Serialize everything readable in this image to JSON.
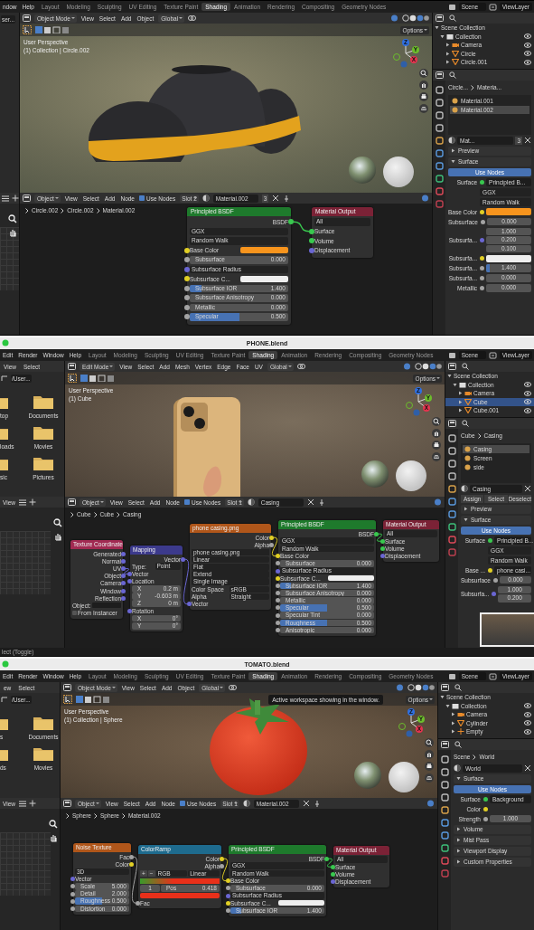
{
  "screens": [
    {
      "menus": [
        "ndow",
        "Help"
      ],
      "workspaces": [
        {
          "label": "Layout",
          "selected": false
        },
        {
          "label": "Modeling",
          "selected": false
        },
        {
          "label": "Sculpting",
          "selected": false
        },
        {
          "label": "UV Editing",
          "selected": false
        },
        {
          "label": "Texture Paint",
          "selected": false
        },
        {
          "label": "Shading",
          "selected": true
        },
        {
          "label": "Animation",
          "selected": false
        },
        {
          "label": "Rendering",
          "selected": false
        },
        {
          "label": "Compositing",
          "selected": false
        },
        {
          "label": "Geometry Nodes",
          "selected": false
        }
      ],
      "scene": "Scene",
      "view_layer": "ViewLayer",
      "file_browser": {
        "path": "ser..."
      },
      "viewport": {
        "mode": "Object Mode",
        "menus": [
          "View",
          "Select",
          "Add",
          "Object"
        ],
        "orientation": "Global",
        "options": "Options",
        "info": [
          "User Perspective",
          "(1) Collection | Circle.002"
        ],
        "axes": [
          "Z",
          "Y",
          "X"
        ],
        "subject": {
          "kind": "shoe"
        }
      },
      "outliner": {
        "items": [
          {
            "label": "Scene Collection",
            "kind": "scene",
            "selected": false,
            "expanded": true,
            "children": [
              {
                "label": "Collection",
                "kind": "collection",
                "selected": false,
                "expanded": true,
                "children": [
                  {
                    "label": "Camera",
                    "kind": "camera",
                    "selected": false,
                    "expanded": false
                  },
                  {
                    "label": "Circle",
                    "kind": "mesh",
                    "selected": false,
                    "expanded": false
                  },
                  {
                    "label": "Circle.001",
                    "kind": "mesh",
                    "selected": false,
                    "expanded": false
                  }
                ]
              }
            ]
          }
        ]
      },
      "properties": {
        "breadcrumb": [
          "Circle...",
          "Materia..."
        ],
        "slots": [
          {
            "label": "Material.001",
            "selected": false
          },
          {
            "label": "Material.002",
            "selected": true
          }
        ],
        "datablock": "Mat...",
        "users": "3",
        "items": [
          {
            "kind": "section",
            "label": "Preview",
            "expanded": false
          },
          {
            "kind": "section",
            "label": "Surface",
            "expanded": true
          },
          {
            "kind": "button",
            "label": "Use Nodes"
          },
          {
            "kind": "link",
            "label": "Surface",
            "value": "Principled B...",
            "socket": {
              "color": "#39c84f"
            }
          },
          {
            "kind": "menu",
            "value": "GGX"
          },
          {
            "kind": "menu",
            "value": "Random Walk"
          },
          {
            "kind": "color",
            "label": "Base Color",
            "socket": {
              "color": "#e1cf25"
            },
            "color": "#f7941d"
          },
          {
            "kind": "number",
            "label": "Subsurface",
            "socket": {
              "color": "#a3a3a3"
            },
            "value": "0.000"
          },
          {
            "kind": "vector",
            "label": "Subsurfa...",
            "socket": {
              "color": "#6a66d2"
            },
            "values": [
              "1.000",
              "0.200",
              "0.100"
            ]
          },
          {
            "kind": "color",
            "label": "Subsurfa...",
            "socket": {
              "color": "#e1cf25"
            },
            "color": "#eeeeee"
          },
          {
            "kind": "number",
            "label": "Subsurfa...",
            "socket": {
              "color": "#a3a3a3"
            },
            "value": "1.400",
            "level": 0.08
          },
          {
            "kind": "number",
            "label": "Subsurfa...",
            "socket": {
              "color": "#a3a3a3"
            },
            "value": "0.000"
          },
          {
            "kind": "number",
            "label": "Metallic",
            "socket": {
              "color": "#a3a3a3"
            },
            "value": "0.000"
          }
        ]
      },
      "node_editor": {
        "mode": "Object",
        "menus": [
          "View",
          "Select",
          "Add",
          "Node"
        ],
        "use_nodes": {
          "label": "Use Nodes",
          "checked": true
        },
        "slot": "Slot 2",
        "material": "Material.002",
        "users": "3",
        "breadcrumb": [
          "Circle.002",
          "Circle.002",
          "Material.002"
        ],
        "nodes": [
          {
            "title": "Principled BSDF",
            "kind": "shader",
            "rows": [
              {
                "kind": "out",
                "label": "BSDF",
                "socket": {
                  "color": "#39c84f"
                }
              },
              {
                "kind": "menu",
                "value": "GGX"
              },
              {
                "kind": "menu",
                "value": "Random Walk"
              },
              {
                "kind": "color",
                "label": "Base Color",
                "socket": {
                  "color": "#e1cf25"
                },
                "color": "#f7941d"
              },
              {
                "kind": "number",
                "label": "Subsurface",
                "socket": {
                  "color": "#a3a3a3"
                },
                "value": "0.000"
              },
              {
                "kind": "menu",
                "label": "Subsurface Radius",
                "socket": {
                  "color": "#6a66d2"
                }
              },
              {
                "kind": "color",
                "label": "Subsurface C...",
                "socket": {
                  "color": "#e1cf25"
                },
                "color": "#eeeeee"
              },
              {
                "kind": "number",
                "label": "Subsurface IOR",
                "socket": {
                  "color": "#a3a3a3"
                },
                "value": "1.400",
                "level": 0.12
              },
              {
                "kind": "number",
                "label": "Subsurface Anisotropy",
                "socket": {
                  "color": "#a3a3a3"
                },
                "value": "0.000"
              },
              {
                "kind": "number",
                "label": "Metallic",
                "socket": {
                  "color": "#a3a3a3"
                },
                "value": "0.000"
              },
              {
                "kind": "number",
                "label": "Specular",
                "socket": {
                  "color": "#a3a3a3"
                },
                "value": "0.500",
                "level": 0.5
              }
            ]
          },
          {
            "title": "Material Output",
            "kind": "output",
            "rows": [
              {
                "kind": "menu",
                "value": "All"
              },
              {
                "kind": "in",
                "label": "Surface",
                "socket": {
                  "color": "#39c84f"
                }
              },
              {
                "kind": "in",
                "label": "Volume",
                "socket": {
                  "color": "#39c84f"
                }
              },
              {
                "kind": "in",
                "label": "Displacement",
                "socket": {
                  "color": "#6a66d2"
                }
              }
            ]
          }
        ]
      }
    },
    {
      "title": "PHONE.blend",
      "menus": [
        "Edit",
        "Render",
        "Window",
        "Help"
      ],
      "workspaces": [
        {
          "label": "Layout",
          "selected": false
        },
        {
          "label": "Modeling",
          "selected": false
        },
        {
          "label": "Sculpting",
          "selected": false
        },
        {
          "label": "UV Editing",
          "selected": false
        },
        {
          "label": "Texture Paint",
          "selected": false
        },
        {
          "label": "Shading",
          "selected": true
        },
        {
          "label": "Animation",
          "selected": false
        },
        {
          "label": "Rendering",
          "selected": false
        },
        {
          "label": "Compositing",
          "selected": false
        },
        {
          "label": "Geometry Nodes",
          "selected": false
        }
      ],
      "scene": "Scene",
      "view_layer": "ViewLayer",
      "file_browser": {
        "menus": [
          "View",
          "Select"
        ],
        "path": "/User...",
        "folders": [
          "top",
          "Documents",
          "loads",
          "Movies",
          "sic",
          "Pictures"
        ]
      },
      "image_editor": {
        "menus": [
          "View"
        ]
      },
      "viewport": {
        "mode": "Edit Mode",
        "menus": [
          "View",
          "Select",
          "Add",
          "Mesh",
          "Vertex",
          "Edge",
          "Face",
          "UV"
        ],
        "orientation": "Global",
        "options": "Options",
        "info": [
          "User Perspective",
          "(1) Cube"
        ],
        "axes": [
          "Z",
          "Y",
          "X"
        ],
        "subject": {
          "kind": "phone"
        }
      },
      "outliner": {
        "items": [
          {
            "label": "Scene Collection",
            "kind": "scene",
            "selected": false,
            "expanded": true,
            "children": [
              {
                "label": "Collection",
                "kind": "collection",
                "selected": false,
                "expanded": true,
                "children": [
                  {
                    "label": "Camera",
                    "kind": "camera",
                    "selected": false,
                    "expanded": false
                  },
                  {
                    "label": "Cube",
                    "kind": "mesh",
                    "selected": true,
                    "expanded": false
                  },
                  {
                    "label": "Cube.001",
                    "kind": "mesh",
                    "selected": false,
                    "expanded": false
                  }
                ]
              }
            ]
          }
        ]
      },
      "properties": {
        "breadcrumb": [
          "Cube",
          "Casing"
        ],
        "slots": [
          {
            "label": "Casing",
            "selected": true
          },
          {
            "label": "Screen",
            "selected": false
          },
          {
            "label": "side",
            "selected": false
          }
        ],
        "datablock": "Casing",
        "buttons": [
          "Assign",
          "Select",
          "Deselect"
        ],
        "items": [
          {
            "kind": "section",
            "label": "Preview",
            "expanded": false
          },
          {
            "kind": "section",
            "label": "Surface",
            "expanded": true
          },
          {
            "kind": "button",
            "label": "Use Nodes"
          },
          {
            "kind": "link",
            "label": "Surface",
            "value": "Principled B...",
            "socket": {
              "color": "#39c84f"
            }
          },
          {
            "kind": "menu",
            "value": "GGX"
          },
          {
            "kind": "menu",
            "value": "Random Walk"
          },
          {
            "kind": "link",
            "label": "Base ...",
            "value": "phone casi...",
            "socket": {
              "color": "#e1cf25"
            }
          },
          {
            "kind": "number",
            "label": "Subsurface",
            "socket": {
              "color": "#a3a3a3"
            },
            "value": "0.000"
          },
          {
            "kind": "vector",
            "label": "Subsurfa...",
            "socket": {
              "color": "#6a66d2"
            },
            "values": [
              "1.000",
              "0.200"
            ]
          }
        ]
      },
      "node_editor": {
        "mode": "Object",
        "menus": [
          "View",
          "Select",
          "Add",
          "Node"
        ],
        "use_nodes": {
          "label": "Use Nodes",
          "checked": true
        },
        "slot": "Slot 1",
        "material": "Casing",
        "breadcrumb": [
          "Cube",
          "Cube",
          "Casing"
        ],
        "nodes": [
          {
            "title": "Texture Coordinate",
            "kind": "input",
            "rows": [
              {
                "kind": "out",
                "label": "Generated",
                "socket": {
                  "color": "#6a66d2"
                }
              },
              {
                "kind": "out",
                "label": "Normal",
                "socket": {
                  "color": "#6a66d2"
                }
              },
              {
                "kind": "out",
                "label": "UV",
                "socket": {
                  "color": "#6a66d2"
                }
              },
              {
                "kind": "out",
                "label": "Object",
                "socket": {
                  "color": "#6a66d2"
                }
              },
              {
                "kind": "out",
                "label": "Camera",
                "socket": {
                  "color": "#6a66d2"
                }
              },
              {
                "kind": "out",
                "label": "Window",
                "socket": {
                  "color": "#6a66d2"
                }
              },
              {
                "kind": "out",
                "label": "Reflection",
                "socket": {
                  "color": "#6a66d2"
                }
              },
              {
                "kind": "object",
                "label": "Object:"
              },
              {
                "kind": "check",
                "label": "From Instancer",
                "checked": false
              }
            ]
          },
          {
            "title": "Mapping",
            "kind": "vector",
            "rows": [
              {
                "kind": "out",
                "label": "Vector",
                "socket": {
                  "color": "#6a66d2"
                }
              },
              {
                "kind": "pair",
                "label": "Type:",
                "value": "Point"
              },
              {
                "kind": "in",
                "label": "Vector",
                "socket": {
                  "color": "#6a66d2"
                }
              },
              {
                "kind": "in",
                "label": "Location",
                "socket": {
                  "color": "#6a66d2"
                }
              },
              {
                "kind": "number",
                "label": "X",
                "value": "0.2 m"
              },
              {
                "kind": "number",
                "label": "Y",
                "value": "-0.603 m"
              },
              {
                "kind": "number",
                "label": "Z",
                "value": "0 m"
              },
              {
                "kind": "in",
                "label": "Rotation",
                "socket": {
                  "color": "#6a66d2"
                }
              },
              {
                "kind": "number",
                "label": "X",
                "value": "0°"
              },
              {
                "kind": "number",
                "label": "Y",
                "value": "0°"
              }
            ]
          },
          {
            "title": "phone casing.png",
            "kind": "texture",
            "rows": [
              {
                "kind": "out",
                "label": "Color",
                "socket": {
                  "color": "#e1cf25"
                }
              },
              {
                "kind": "out",
                "label": "Alpha",
                "socket": {
                  "color": "#a3a3a3"
                }
              },
              {
                "kind": "file",
                "value": "phone casing.png"
              },
              {
                "kind": "menu",
                "value": "Linear"
              },
              {
                "kind": "menu",
                "value": "Flat"
              },
              {
                "kind": "menu",
                "value": "Extend"
              },
              {
                "kind": "menu",
                "value": "Single Image"
              },
              {
                "kind": "pair",
                "label": "Color Space",
                "value": "sRGB"
              },
              {
                "kind": "pair",
                "label": "Alpha",
                "value": "Straight"
              },
              {
                "kind": "in",
                "label": "Vector",
                "socket": {
                  "color": "#6a66d2"
                }
              }
            ]
          },
          {
            "title": "Principled BSDF",
            "kind": "shader",
            "rows": [
              {
                "kind": "out",
                "label": "BSDF",
                "socket": {
                  "color": "#39c84f"
                }
              },
              {
                "kind": "menu",
                "value": "GGX"
              },
              {
                "kind": "menu",
                "value": "Random Walk"
              },
              {
                "kind": "in",
                "label": "Base Color",
                "socket": {
                  "color": "#e1cf25"
                }
              },
              {
                "kind": "number",
                "label": "Subsurface",
                "socket": {
                  "color": "#a3a3a3"
                },
                "value": "0.000"
              },
              {
                "kind": "menu",
                "label": "Subsurface Radius",
                "socket": {
                  "color": "#6a66d2"
                }
              },
              {
                "kind": "color",
                "label": "Subsurface C...",
                "socket": {
                  "color": "#e1cf25"
                },
                "color": "#eeeeee"
              },
              {
                "kind": "number",
                "label": "Subsurface IOR",
                "socket": {
                  "color": "#a3a3a3"
                },
                "value": "1.400",
                "level": 0.12
              },
              {
                "kind": "number",
                "label": "Subsurface Anisotropy",
                "socket": {
                  "color": "#a3a3a3"
                },
                "value": "0.000"
              },
              {
                "kind": "number",
                "label": "Metallic",
                "socket": {
                  "color": "#a3a3a3"
                },
                "value": "0.000"
              },
              {
                "kind": "number",
                "label": "Specular",
                "socket": {
                  "color": "#a3a3a3"
                },
                "value": "0.500",
                "level": 0.5
              },
              {
                "kind": "number",
                "label": "Specular Tint",
                "socket": {
                  "color": "#a3a3a3"
                },
                "value": "0.000"
              },
              {
                "kind": "number",
                "label": "Roughness",
                "socket": {
                  "color": "#a3a3a3"
                },
                "value": "0.500",
                "level": 0.5
              },
              {
                "kind": "number",
                "label": "Anisotropic",
                "socket": {
                  "color": "#a3a3a3"
                },
                "value": "0.000"
              }
            ]
          },
          {
            "title": "Material Output",
            "kind": "output",
            "rows": [
              {
                "kind": "menu",
                "value": "All"
              },
              {
                "kind": "in",
                "label": "Surface",
                "socket": {
                  "color": "#39c84f"
                }
              },
              {
                "kind": "in",
                "label": "Volume",
                "socket": {
                  "color": "#39c84f"
                }
              },
              {
                "kind": "in",
                "label": "Displacement",
                "socket": {
                  "color": "#6a66d2"
                }
              }
            ]
          }
        ]
      },
      "status": [
        "lect (Toggle)"
      ]
    },
    {
      "title": "TOMATO.blend",
      "menus": [
        "Edit",
        "Render",
        "Window",
        "Help"
      ],
      "workspaces": [
        {
          "label": "Layout",
          "selected": false
        },
        {
          "label": "Modeling",
          "selected": false
        },
        {
          "label": "Sculpting",
          "selected": false
        },
        {
          "label": "UV Editing",
          "selected": false
        },
        {
          "label": "Texture Paint",
          "selected": false
        },
        {
          "label": "Shading",
          "selected": true
        },
        {
          "label": "Animation",
          "selected": false
        },
        {
          "label": "Rendering",
          "selected": false
        },
        {
          "label": "Compositing",
          "selected": false
        },
        {
          "label": "Geometry Nodes",
          "selected": false
        }
      ],
      "scene": "Scene",
      "view_layer": "ViewLayer",
      "file_browser": {
        "menus": [
          "ew",
          "Select"
        ],
        "path": "/User...",
        "folders": [
          "s",
          "Documents",
          "ds",
          "Movies"
        ]
      },
      "image_editor": {
        "menus": [
          "View"
        ]
      },
      "viewport": {
        "mode": "Object Mode",
        "menus": [
          "View",
          "Select",
          "Add",
          "Object"
        ],
        "orientation": "Global",
        "options": "Options",
        "info": [
          "User Perspective",
          "(1) Collection | Sphere"
        ],
        "axes": [
          "Z",
          "Y",
          "X"
        ],
        "subject": {
          "kind": "tomato"
        },
        "tooltip": "Active workspace showing in the window."
      },
      "outliner": {
        "items": [
          {
            "label": "Scene Collection",
            "kind": "scene",
            "selected": false,
            "expanded": true,
            "children": [
              {
                "label": "Collection",
                "kind": "collection",
                "selected": false,
                "expanded": true,
                "children": [
                  {
                    "label": "Camera",
                    "kind": "camera",
                    "selected": false,
                    "expanded": false
                  },
                  {
                    "label": "Cylinder",
                    "kind": "mesh",
                    "selected": false,
                    "expanded": false
                  },
                  {
                    "label": "Empty",
                    "kind": "empty",
                    "selected": false,
                    "expanded": false
                  }
                ]
              }
            ]
          }
        ]
      },
      "properties": {
        "breadcrumb": [
          "Scene",
          "World"
        ],
        "datablock": "World",
        "items": [
          {
            "kind": "section",
            "label": "Surface",
            "expanded": true
          },
          {
            "kind": "button",
            "label": "Use Nodes"
          },
          {
            "kind": "link",
            "label": "Surface",
            "value": "Background",
            "socket": {
              "color": "#39c84f"
            }
          },
          {
            "kind": "socket",
            "label": "Color",
            "socket": {
              "color": "#e1cf25"
            }
          },
          {
            "kind": "number",
            "label": "Strength",
            "socket": {
              "color": "#a3a3a3"
            },
            "value": "1.000"
          },
          {
            "kind": "section",
            "label": "Volume",
            "expanded": false
          },
          {
            "kind": "section",
            "label": "Mist Pass",
            "expanded": false
          },
          {
            "kind": "section",
            "label": "Viewport Display",
            "expanded": false
          },
          {
            "kind": "section",
            "label": "Custom Properties",
            "expanded": false
          }
        ]
      },
      "node_editor": {
        "mode": "Object",
        "menus": [
          "View",
          "Select",
          "Add",
          "Node"
        ],
        "use_nodes": {
          "label": "Use Nodes",
          "checked": true
        },
        "slot": "Slot 1",
        "material": "Material.002",
        "breadcrumb": [
          "Sphere",
          "Sphere",
          "Material.002"
        ],
        "nodes": [
          {
            "title": "Noise Texture",
            "kind": "texture",
            "rows": [
              {
                "kind": "out",
                "label": "Fac",
                "socket": {
                  "color": "#a3a3a3"
                }
              },
              {
                "kind": "out",
                "label": "Color",
                "socket": {
                  "color": "#e1cf25"
                }
              },
              {
                "kind": "menu",
                "value": "3D"
              },
              {
                "kind": "in",
                "label": "Vector",
                "socket": {
                  "color": "#6a66d2"
                }
              },
              {
                "kind": "number",
                "label": "Scale",
                "socket": {
                  "color": "#a3a3a3"
                },
                "value": "5.000"
              },
              {
                "kind": "number",
                "label": "Detail",
                "socket": {
                  "color": "#a3a3a3"
                },
                "value": "2.000"
              },
              {
                "kind": "number",
                "label": "Roughness",
                "socket": {
                  "color": "#a3a3a3"
                },
                "value": "0.500",
                "level": 0.5
              },
              {
                "kind": "number",
                "label": "Distortion",
                "socket": {
                  "color": "#a3a3a3"
                },
                "value": "0.000"
              }
            ]
          },
          {
            "title": "ColorRamp",
            "kind": "converter",
            "rows": [
              {
                "kind": "out",
                "label": "Color",
                "socket": {
                  "color": "#e1cf25"
                }
              },
              {
                "kind": "out",
                "label": "Alpha",
                "socket": {
                  "color": "#a3a3a3"
                }
              },
              {
                "kind": "ramp_mode",
                "values": [
                  "+",
                  "−",
                  "RGB",
                  "Linear"
                ]
              },
              {
                "kind": "gradient"
              },
              {
                "kind": "stop",
                "values": [
                  "1",
                  "Pos",
                  "0.418"
                ]
              },
              {
                "kind": "swatch",
                "color": "#e8301a"
              },
              {
                "kind": "in",
                "label": "Fac",
                "socket": {
                  "color": "#a3a3a3"
                }
              }
            ]
          },
          {
            "title": "Principled BSDF",
            "kind": "shader",
            "rows": [
              {
                "kind": "out",
                "label": "BSDF",
                "socket": {
                  "color": "#39c84f"
                }
              },
              {
                "kind": "menu",
                "value": "GGX"
              },
              {
                "kind": "menu",
                "value": "Random Walk"
              },
              {
                "kind": "in",
                "label": "Base Color",
                "socket": {
                  "color": "#e1cf25"
                }
              },
              {
                "kind": "number",
                "label": "Subsurface",
                "socket": {
                  "color": "#a3a3a3"
                },
                "value": "0.000"
              },
              {
                "kind": "menu",
                "label": "Subsurface Radius",
                "socket": {
                  "color": "#6a66d2"
                }
              },
              {
                "kind": "color",
                "label": "Subsurface C...",
                "socket": {
                  "color": "#e1cf25"
                },
                "color": "#eeeeee"
              },
              {
                "kind": "number",
                "label": "Subsurface IOR",
                "socket": {
                  "color": "#a3a3a3"
                },
                "value": "1.400",
                "level": 0.12
              }
            ]
          },
          {
            "title": "Material Output",
            "kind": "output",
            "rows": [
              {
                "kind": "menu",
                "value": "All"
              },
              {
                "kind": "in",
                "label": "Surface",
                "socket": {
                  "color": "#39c84f"
                }
              },
              {
                "kind": "in",
                "label": "Volume",
                "socket": {
                  "color": "#39c84f"
                }
              },
              {
                "kind": "in",
                "label": "Displacement",
                "socket": {
                  "color": "#6a66d2"
                }
              }
            ]
          }
        ]
      }
    }
  ]
}
